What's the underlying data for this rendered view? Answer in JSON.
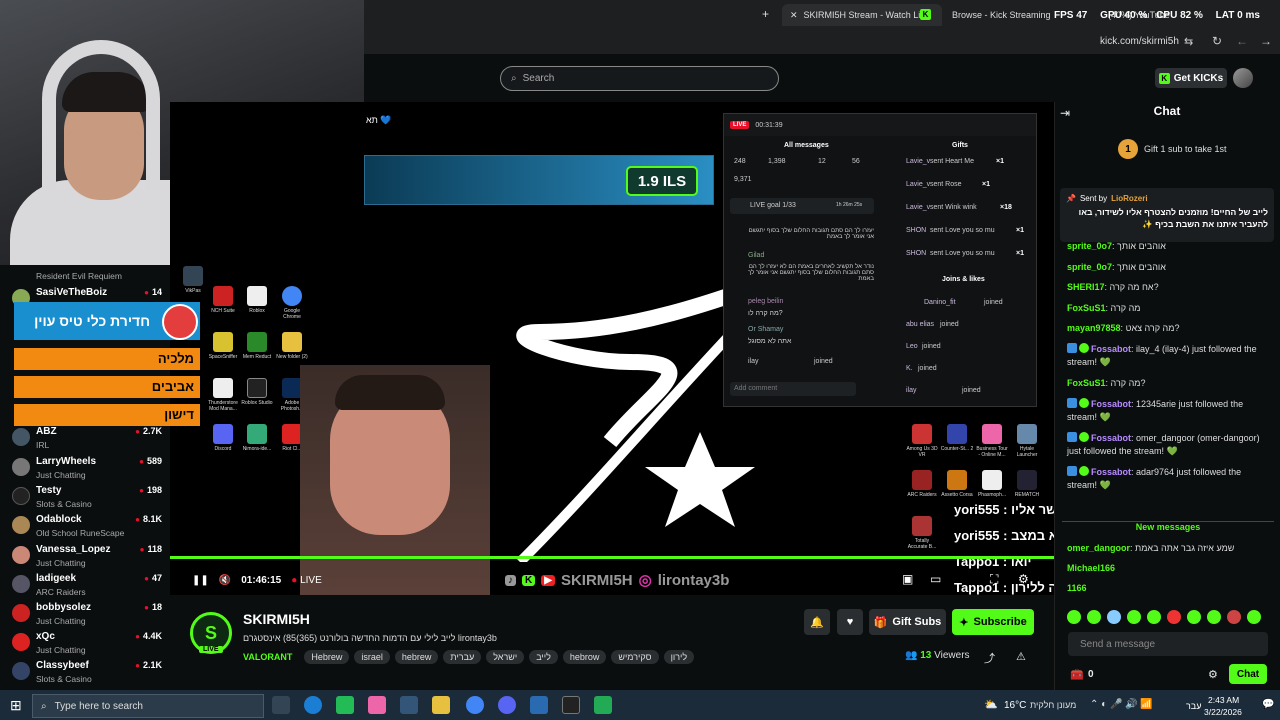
{
  "browser": {
    "tabs": [
      {
        "label": "SKIRMI5H Stream - Watch Live"
      },
      {
        "label": "Browse - Kick Streaming"
      },
      {
        "label": "(40%) YouTube"
      }
    ],
    "url": "kick.com/skirmi5h",
    "perf": {
      "fps_label": "FPS",
      "fps": "47",
      "gpu_label": "GPU",
      "gpu": "40 %",
      "cpu_label": "CPU",
      "cpu": "82 %",
      "lat_label": "LAT",
      "lat": "0 ms"
    }
  },
  "header": {
    "search_placeholder": "Search",
    "get_kicks": "Get KICKs"
  },
  "sidebar": {
    "top_game": "Resident Evil Requiem",
    "channels": [
      {
        "name": "SasiVeTheBoiz",
        "viewers": "14",
        "game": ""
      },
      {
        "name": "ABZ",
        "viewers": "2.7K",
        "game": "IRL"
      },
      {
        "name": "LarryWheels",
        "viewers": "589",
        "game": "Just Chatting"
      },
      {
        "name": "Testy",
        "viewers": "198",
        "game": "Slots & Casino"
      },
      {
        "name": "Odablock",
        "viewers": "8.1K",
        "game": "Old School RuneScape"
      },
      {
        "name": "Vanessa_Lopez",
        "viewers": "118",
        "game": "Just Chatting"
      },
      {
        "name": "ladigeek",
        "viewers": "47",
        "game": "ARC Raiders"
      },
      {
        "name": "bobbysolez",
        "viewers": "18",
        "game": "Just Chatting"
      },
      {
        "name": "xQc",
        "viewers": "4.4K",
        "game": "Just Chatting"
      },
      {
        "name": "Classybeef",
        "viewers": "2.1K",
        "game": "Slots & Casino"
      }
    ]
  },
  "overlay": {
    "poll_title": "חדירת כלי טיס עוין",
    "poll_options": [
      "מלכיה",
      "אביבים",
      "דישון"
    ],
    "ils": "1.9 ILS",
    "hebrew_top": "תא 💙",
    "dashboard": {
      "timer": "00:31:39",
      "all_messages": "All messages",
      "gifts": "Gifts",
      "stats": [
        "248",
        "1,398",
        "12",
        "56"
      ],
      "likes": "9,371",
      "live_goal": "LIVE goal 1/33",
      "live_goal_time": "1h 26m 25s",
      "messages": [
        {
          "user": "",
          "text": "יעזרו לך הם סתם תגובות החלום שלך בסוף יתגשם אני אומר לך באמת"
        },
        {
          "user": "Gilad",
          "text": "נודר אל תקשיב לאחרים באמת הם לא יעזרו לך הם סתם תגובות החלום שלך בסוף יתגשם אני אומר לך באמת"
        },
        {
          "user": "peleg beilin",
          "text": "מה קרה לו?"
        },
        {
          "user": "Or Shamay",
          "text": "אתה לא מסוגל"
        },
        {
          "user": "ilay",
          "text": "joined"
        }
      ],
      "add_comment": "Add comment",
      "gift_rows": [
        {
          "user": "Lavie_v",
          "text": "sent Heart Me",
          "count": "×1"
        },
        {
          "user": "Lavie_v",
          "text": "sent Rose",
          "count": "×1"
        },
        {
          "user": "Lavie_v",
          "text": "sent Wink wink",
          "count": "×18"
        },
        {
          "user": "SHON",
          "text": "sent Love you so mu",
          "count": "×1"
        },
        {
          "user": "SHON",
          "text": "sent Love you so mu",
          "count": "×1"
        }
      ],
      "joins_title": "Joins & likes",
      "joins": [
        {
          "user": "Danino_fit",
          "text": "joined"
        },
        {
          "user": "abu elias",
          "text": "joined"
        },
        {
          "user": "Leo",
          "text": "joined"
        },
        {
          "user": "K.",
          "text": "joined"
        },
        {
          "user": "ilay",
          "text": "joined"
        }
      ]
    },
    "stream_chat": [
      {
        "text": "yori555 : אל תתקשר אליו"
      },
      {
        "text": "yori555 : הוא לא במצב"
      },
      {
        "text": "Tappo1 : יואו"
      },
      {
        "text": "Tappo1 : מה קרה ללירון?"
      }
    ],
    "socials": "SKIRMI5H",
    "socials2": "lirontay3b"
  },
  "desktop": {
    "icons": [
      "VikPas",
      "NCH Suite",
      "Roblox",
      "Google Chrome",
      "SpaceSniffer",
      "Mem Reduct",
      "New folder (2)",
      "Thunderstore Mod Mana...",
      "Roblox Studio",
      "Adobe Photosh...",
      "Discord",
      "Nimora-ide...",
      "Riot Cl...",
      "Among Us 3D VR",
      "Counter-St... 2",
      "Business Tour - Online M...",
      "Hytale Launcher",
      "ARC Raiders",
      "Assetto Corsa",
      "Phasmoph...",
      "REMATCH",
      "Totally Accurate B..."
    ]
  },
  "player": {
    "time": "01:46:15",
    "live": "LIVE"
  },
  "channel": {
    "name": "SKIRMI5H",
    "title": "לייב לילי עם הדמות החדשה בולורנט (365)85) אינסטגרם lirontay3b",
    "category": "VALORANT",
    "tags": [
      "Hebrew",
      "israel",
      "hebrew",
      "עברית",
      "ישראל",
      "לייב",
      "hebrow",
      "סקירמיש",
      "לירון"
    ],
    "gift_subs": "Gift Subs",
    "subscribe": "Subscribe",
    "viewers_count": "13",
    "viewers_label": "Viewers"
  },
  "chat": {
    "title": "Chat",
    "gift_banner": "Gift 1 sub to take 1st",
    "pinned_sender_label": "Sent by",
    "pinned_sender": "LioRozeri",
    "pinned_text": "לייב של החיים! מוזמנים להצטרף אליו לשידור, באו להעביר איתנו את השבת בכיף ✨",
    "messages": [
      {
        "user": "sprite_0o7",
        "text": "אוהבים אותך"
      },
      {
        "user": "sprite_0o7",
        "text": "אוהבים אותך"
      },
      {
        "user": "SHERI17",
        "text": "אח מה קרה?"
      },
      {
        "user": "FoxSuS1",
        "text": "מה קרה"
      },
      {
        "user": "mayan97858",
        "text": "מה קרה צאט?"
      },
      {
        "user": "Fossabot",
        "text": "ilay_4 (ilay-4) just followed the stream! 💚"
      },
      {
        "user": "FoxSuS1",
        "text": "מה קרה?"
      },
      {
        "user": "Fossabot",
        "text": "12345arie just followed the stream! 💚"
      },
      {
        "user": "Fossabot",
        "text": "omer_dangoor (omer-dangoor) just followed the stream! 💚"
      },
      {
        "user": "Fossabot",
        "text": "adar9764 just followed the stream! 💚"
      }
    ],
    "new_messages": "New messages",
    "after": [
      {
        "user": "omer_dangoor",
        "text": "שמע איזה גבר אתה באמת"
      },
      {
        "user": "Michael166",
        "text": ""
      },
      {
        "user": "Tappo1",
        "text": ""
      },
      {
        "user": "1166",
        "text": ""
      }
    ],
    "send_placeholder": "Send a message",
    "points": "0",
    "chat_button": "Chat"
  },
  "taskbar": {
    "search_placeholder": "Type here to search",
    "weather": "16°C",
    "weather_text": "מעונן חלקית",
    "lang": "עבר",
    "time": "2:43 AM",
    "date": "3/22/2026"
  },
  "colors": {
    "accent": "#53fc18",
    "live_red": "#e9112a",
    "poll_blue": "#1a8fd0",
    "poll_orange": "#f28a12"
  }
}
